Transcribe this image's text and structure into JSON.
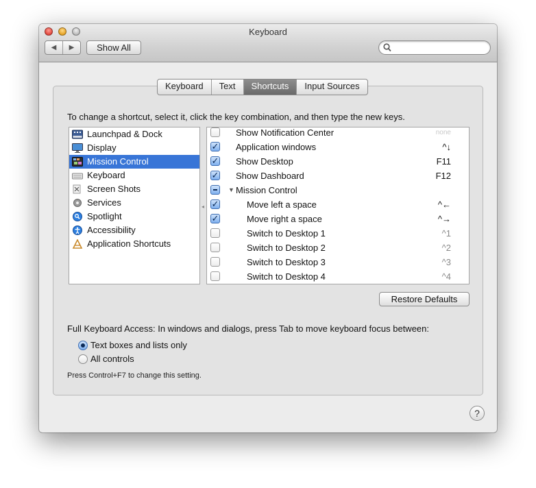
{
  "window": {
    "title": "Keyboard"
  },
  "toolbar": {
    "back_icon": "◀",
    "forward_icon": "▶",
    "show_all_label": "Show All",
    "search_value": "",
    "search_placeholder": ""
  },
  "tabs": [
    {
      "label": "Keyboard"
    },
    {
      "label": "Text"
    },
    {
      "label": "Shortcuts",
      "active": true
    },
    {
      "label": "Input Sources"
    }
  ],
  "instruction": "To change a shortcut, select it, click the key combination, and then type the new keys.",
  "categories": [
    {
      "label": "Launchpad & Dock",
      "icon": "launchpad-dock-icon"
    },
    {
      "label": "Display",
      "icon": "display-icon"
    },
    {
      "label": "Mission Control",
      "icon": "mission-control-icon",
      "selected": true
    },
    {
      "label": "Keyboard",
      "icon": "keyboard-icon"
    },
    {
      "label": "Screen Shots",
      "icon": "screenshot-icon"
    },
    {
      "label": "Services",
      "icon": "services-gear-icon"
    },
    {
      "label": "Spotlight",
      "icon": "spotlight-icon"
    },
    {
      "label": "Accessibility",
      "icon": "accessibility-icon"
    },
    {
      "label": "Application Shortcuts",
      "icon": "app-shortcuts-icon"
    }
  ],
  "shortcuts": [
    {
      "label": "Show Notification Center",
      "key": "none",
      "state": "unchecked"
    },
    {
      "label": "Application windows",
      "key": "^↓",
      "state": "checked"
    },
    {
      "label": "Show Desktop",
      "key": "F11",
      "state": "checked"
    },
    {
      "label": "Show Dashboard",
      "key": "F12",
      "state": "checked"
    },
    {
      "label": "Mission Control",
      "key": "",
      "state": "mixed",
      "group": true
    },
    {
      "label": "Move left a space",
      "key": "^←",
      "state": "checked"
    },
    {
      "label": "Move right a space",
      "key": "^→",
      "state": "checked"
    },
    {
      "label": "Switch to Desktop 1",
      "key": "^1",
      "state": "unchecked"
    },
    {
      "label": "Switch to Desktop 2",
      "key": "^2",
      "state": "unchecked"
    },
    {
      "label": "Switch to Desktop 3",
      "key": "^3",
      "state": "unchecked"
    },
    {
      "label": "Switch to Desktop 4",
      "key": "^4",
      "state": "unchecked"
    }
  ],
  "restore_defaults_label": "Restore Defaults",
  "full_keyboard_access": {
    "text": "Full Keyboard Access: In windows and dialogs, press Tab to move keyboard focus between:",
    "options": [
      {
        "label": "Text boxes and lists only",
        "selected": true
      },
      {
        "label": "All controls",
        "selected": false
      }
    ],
    "hint": "Press Control+F7 to change this setting."
  },
  "help_label": "?",
  "colors": {
    "selection": "#3875d7",
    "checkbox_fill": "#7fb0ee"
  }
}
